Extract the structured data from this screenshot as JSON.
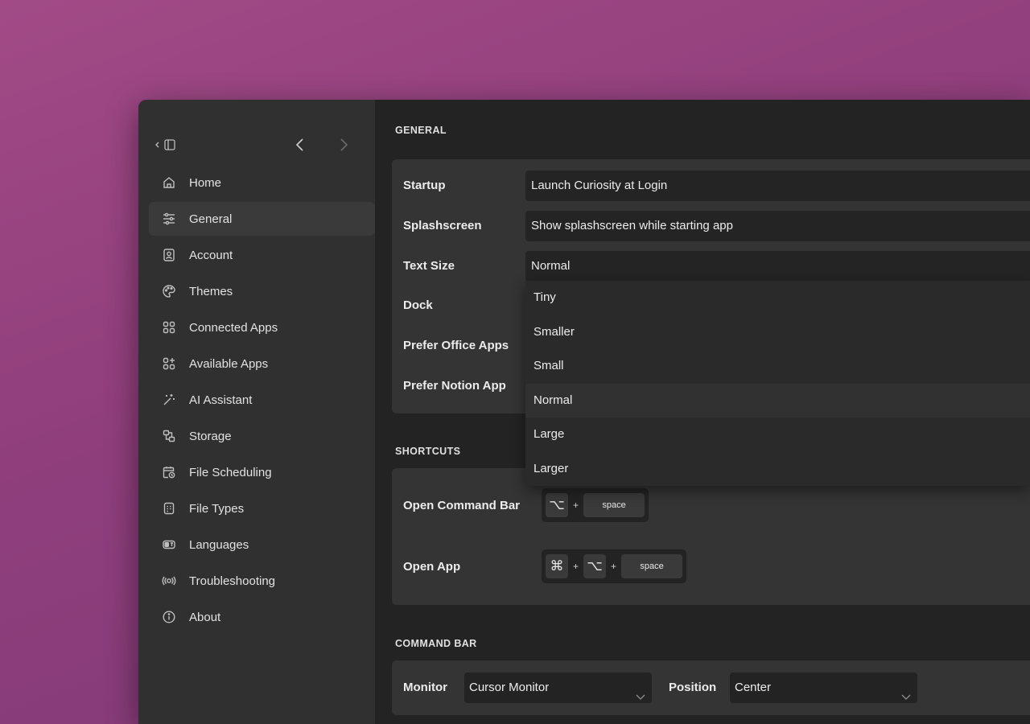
{
  "sidebar": {
    "items": [
      {
        "label": "Home",
        "icon": "home-icon"
      },
      {
        "label": "General",
        "icon": "sliders-icon",
        "active": true
      },
      {
        "label": "Account",
        "icon": "account-icon"
      },
      {
        "label": "Themes",
        "icon": "palette-icon"
      },
      {
        "label": "Connected Apps",
        "icon": "grid-icon"
      },
      {
        "label": "Available Apps",
        "icon": "grid-plus-icon"
      },
      {
        "label": "AI Assistant",
        "icon": "magic-wand-icon"
      },
      {
        "label": "Storage",
        "icon": "storage-icon"
      },
      {
        "label": "File Scheduling",
        "icon": "calendar-clock-icon"
      },
      {
        "label": "File Types",
        "icon": "file-types-icon"
      },
      {
        "label": "Languages",
        "icon": "languages-icon"
      },
      {
        "label": "Troubleshooting",
        "icon": "broadcast-icon"
      },
      {
        "label": "About",
        "icon": "info-icon"
      }
    ]
  },
  "general": {
    "title": "GENERAL",
    "startup": {
      "label": "Startup",
      "value": "Launch Curiosity at Login"
    },
    "splashscreen": {
      "label": "Splashscreen",
      "value": "Show splashscreen while starting app"
    },
    "text_size": {
      "label": "Text Size",
      "value": "Normal",
      "options": [
        "Tiny",
        "Smaller",
        "Small",
        "Normal",
        "Large",
        "Larger"
      ],
      "selected": "Normal"
    },
    "dock": {
      "label": "Dock"
    },
    "prefer_office": {
      "label": "Prefer Office Apps"
    },
    "prefer_notion": {
      "label": "Prefer Notion App"
    }
  },
  "shortcuts": {
    "title": "SHORTCUTS",
    "open_command_bar": {
      "label": "Open Command Bar",
      "keys": [
        "⌥",
        "space"
      ],
      "plus": "+"
    },
    "open_app": {
      "label": "Open App",
      "keys": [
        "⌘",
        "⌥",
        "space"
      ],
      "plus": "+"
    }
  },
  "command_bar": {
    "title": "COMMAND BAR",
    "monitor": {
      "label": "Monitor",
      "value": "Cursor Monitor"
    },
    "position": {
      "label": "Position",
      "value": "Center"
    }
  }
}
